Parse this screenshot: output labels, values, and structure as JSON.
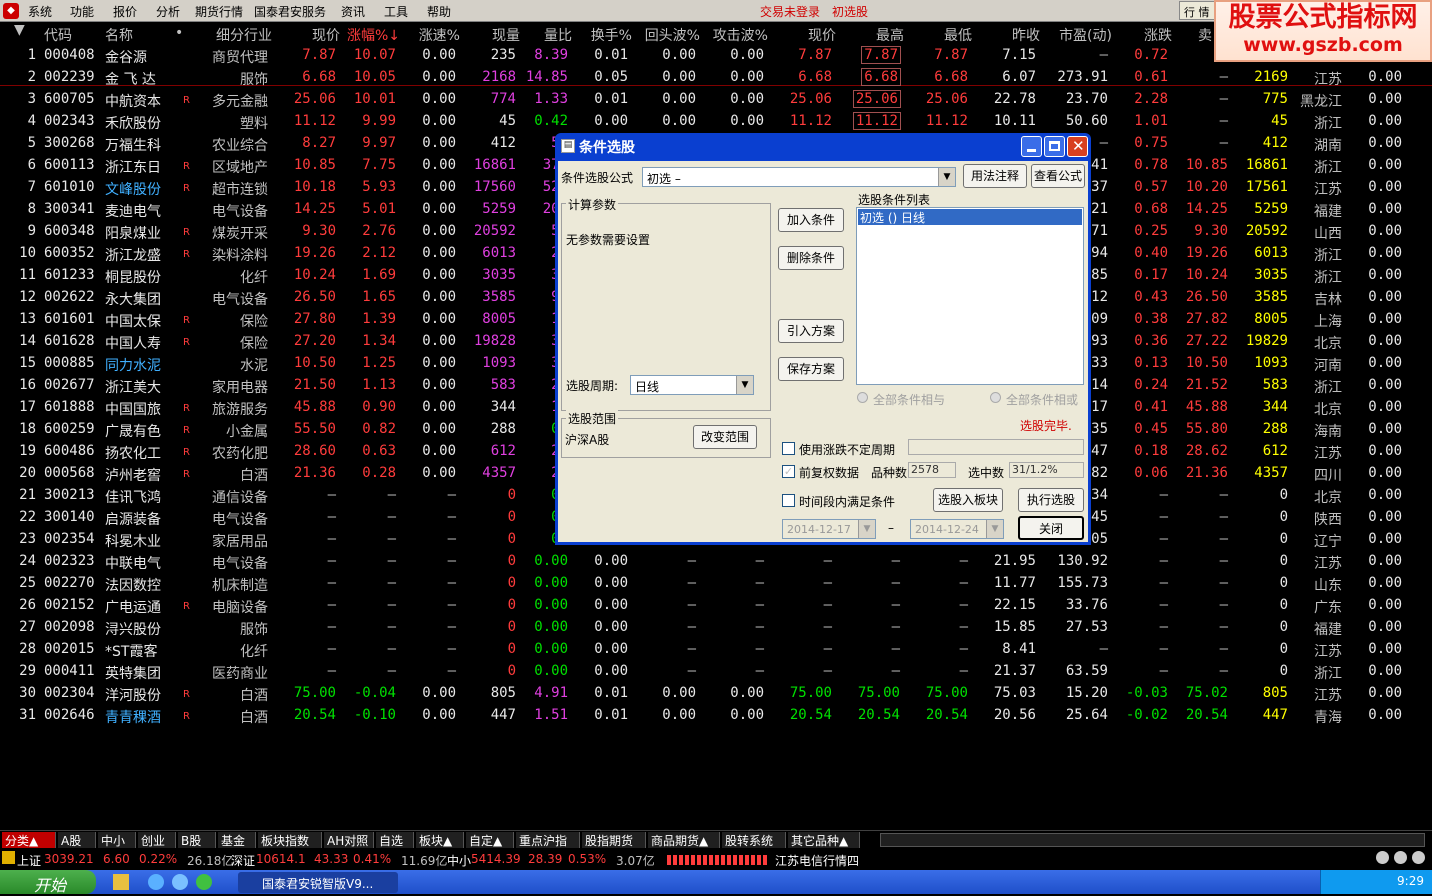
{
  "menu": {
    "items": [
      "系统",
      "功能",
      "报价",
      "分析",
      "期货行情",
      "国泰君安服务",
      "资讯",
      "工具",
      "帮助"
    ],
    "status_login": "交易未登录",
    "status_filter": "初选股",
    "right_btn": "行 情"
  },
  "watermark": {
    "line1": "股票公式指标网",
    "line2": "www.gszb.com"
  },
  "columns": [
    "代码",
    "名称",
    "•",
    "细分行业",
    "现价",
    "涨幅%↓",
    "涨速%",
    "现量",
    "量比",
    "换手%",
    "回头波%",
    "攻击波%",
    "现价",
    "最高",
    "最低",
    "昨收",
    "市盈(动)",
    "涨跌",
    "卖",
    "",
    "",
    ""
  ],
  "rows": [
    {
      "n": "1",
      "code": "000408",
      "name": "金谷源",
      "r": "",
      "ind": "商贸代理",
      "price": "7.87",
      "chg": "10.07",
      "spd": "0.00",
      "vol": "235",
      "vr": "8.39",
      "to": "0.01",
      "hb": "0.00",
      "ab": "0.00",
      "p2": "7.87",
      "hi": "7.87",
      "lo": "7.87",
      "pc": "7.15",
      "pe": "–",
      "ud": "0.72",
      "sell": "",
      "amt": "",
      "reg": "",
      "x": ""
    },
    {
      "n": "2",
      "code": "002239",
      "name": "金 飞 达",
      "r": "",
      "ind": "服饰",
      "price": "6.68",
      "chg": "10.05",
      "spd": "0.00",
      "vol": "2168",
      "vr": "14.85",
      "to": "0.05",
      "hb": "0.00",
      "ab": "0.00",
      "p2": "6.68",
      "hi": "6.68",
      "lo": "6.68",
      "pc": "6.07",
      "pe": "273.91",
      "ud": "0.61",
      "sell": "–",
      "amt": "2169",
      "reg": "江苏",
      "x": "0.00"
    },
    {
      "n": "3",
      "code": "600705",
      "name": "中航资本",
      "r": "R",
      "ind": "多元金融",
      "price": "25.06",
      "chg": "10.01",
      "spd": "0.00",
      "vol": "774",
      "vr": "1.33",
      "to": "0.01",
      "hb": "0.00",
      "ab": "0.00",
      "p2": "25.06",
      "hi": "25.06",
      "lo": "25.06",
      "pc": "22.78",
      "pe": "23.70",
      "ud": "2.28",
      "sell": "–",
      "amt": "775",
      "reg": "黑龙江",
      "x": "0.00"
    },
    {
      "n": "4",
      "code": "002343",
      "name": "禾欣股份",
      "r": "",
      "ind": "塑料",
      "price": "11.12",
      "chg": "9.99",
      "spd": "0.00",
      "vol": "45",
      "vr": "0.42",
      "to": "0.00",
      "hb": "0.00",
      "ab": "0.00",
      "p2": "11.12",
      "hi": "11.12",
      "lo": "11.12",
      "pc": "10.11",
      "pe": "50.60",
      "ud": "1.01",
      "sell": "–",
      "amt": "45",
      "reg": "浙江",
      "x": "0.00"
    },
    {
      "n": "5",
      "code": "300268",
      "name": "万福生科",
      "r": "",
      "ind": "农业综合",
      "price": "8.27",
      "chg": "9.97",
      "spd": "0.00",
      "vol": "412",
      "vr": "5.",
      "to": "",
      "hb": "",
      "ab": "",
      "p2": "",
      "hi": "",
      "lo": "",
      "pc": "",
      "pe": "–",
      "ud": "0.75",
      "sell": "–",
      "amt": "412",
      "reg": "湖南",
      "x": "0.00"
    },
    {
      "n": "6",
      "code": "600113",
      "name": "浙江东日",
      "r": "R",
      "ind": "区域地产",
      "price": "10.85",
      "chg": "7.75",
      "spd": "0.00",
      "vol": "16861",
      "vr": "37.",
      "to": "",
      "hb": "",
      "ab": "",
      "p2": "",
      "hi": "",
      "lo": "",
      "pc": "",
      "pe": "41",
      "ud": "0.78",
      "sell": "10.85",
      "amt": "16861",
      "reg": "浙江",
      "x": "0.00"
    },
    {
      "n": "7",
      "code": "601010",
      "name": "文峰股份",
      "r": "R",
      "ind": "超市连锁",
      "price": "10.18",
      "chg": "5.93",
      "spd": "0.00",
      "vol": "17560",
      "vr": "52.",
      "to": "",
      "hb": "",
      "ab": "",
      "p2": "",
      "hi": "",
      "lo": "",
      "pc": "",
      "pe": "37",
      "ud": "0.57",
      "sell": "10.20",
      "amt": "17561",
      "reg": "江苏",
      "x": "0.00"
    },
    {
      "n": "8",
      "code": "300341",
      "name": "麦迪电气",
      "r": "",
      "ind": "电气设备",
      "price": "14.25",
      "chg": "5.01",
      "spd": "0.00",
      "vol": "5259",
      "vr": "20.",
      "to": "",
      "hb": "",
      "ab": "",
      "p2": "",
      "hi": "",
      "lo": "",
      "pc": "",
      "pe": "21",
      "ud": "0.68",
      "sell": "14.25",
      "amt": "5259",
      "reg": "福建",
      "x": "0.00"
    },
    {
      "n": "9",
      "code": "600348",
      "name": "阳泉煤业",
      "r": "R",
      "ind": "煤炭开采",
      "price": "9.30",
      "chg": "2.76",
      "spd": "0.00",
      "vol": "20592",
      "vr": "5.",
      "to": "",
      "hb": "",
      "ab": "",
      "p2": "",
      "hi": "",
      "lo": "",
      "pc": "",
      "pe": "71",
      "ud": "0.25",
      "sell": "9.30",
      "amt": "20592",
      "reg": "山西",
      "x": "0.00"
    },
    {
      "n": "10",
      "code": "600352",
      "name": "浙江龙盛",
      "r": "R",
      "ind": "染料涂料",
      "price": "19.26",
      "chg": "2.12",
      "spd": "0.00",
      "vol": "6013",
      "vr": "2.",
      "to": "",
      "hb": "",
      "ab": "",
      "p2": "",
      "hi": "",
      "lo": "",
      "pc": "",
      "pe": "94",
      "ud": "0.40",
      "sell": "19.26",
      "amt": "6013",
      "reg": "浙江",
      "x": "0.00"
    },
    {
      "n": "11",
      "code": "601233",
      "name": "桐昆股份",
      "r": "",
      "ind": "化纤",
      "price": "10.24",
      "chg": "1.69",
      "spd": "0.00",
      "vol": "3035",
      "vr": "3.",
      "to": "",
      "hb": "",
      "ab": "",
      "p2": "",
      "hi": "",
      "lo": "",
      "pc": "",
      "pe": "85",
      "ud": "0.17",
      "sell": "10.24",
      "amt": "3035",
      "reg": "浙江",
      "x": "0.00"
    },
    {
      "n": "12",
      "code": "002622",
      "name": "永大集团",
      "r": "",
      "ind": "电气设备",
      "price": "26.50",
      "chg": "1.65",
      "spd": "0.00",
      "vol": "3585",
      "vr": "9.",
      "to": "",
      "hb": "",
      "ab": "",
      "p2": "",
      "hi": "",
      "lo": "",
      "pc": "",
      "pe": "12",
      "ud": "0.43",
      "sell": "26.50",
      "amt": "3585",
      "reg": "吉林",
      "x": "0.00"
    },
    {
      "n": "13",
      "code": "601601",
      "name": "中国太保",
      "r": "R",
      "ind": "保险",
      "price": "27.80",
      "chg": "1.39",
      "spd": "0.00",
      "vol": "8005",
      "vr": "1.",
      "to": "",
      "hb": "",
      "ab": "",
      "p2": "",
      "hi": "",
      "lo": "",
      "pc": "",
      "pe": "09",
      "ud": "0.38",
      "sell": "27.82",
      "amt": "8005",
      "reg": "上海",
      "x": "0.00"
    },
    {
      "n": "14",
      "code": "601628",
      "name": "中国人寿",
      "r": "R",
      "ind": "保险",
      "price": "27.20",
      "chg": "1.34",
      "spd": "0.00",
      "vol": "19828",
      "vr": "3.",
      "to": "",
      "hb": "",
      "ab": "",
      "p2": "",
      "hi": "",
      "lo": "",
      "pc": "",
      "pe": "93",
      "ud": "0.36",
      "sell": "27.22",
      "amt": "19829",
      "reg": "北京",
      "x": "0.00"
    },
    {
      "n": "15",
      "code": "000885",
      "name": "同力水泥",
      "r": "",
      "ind": "水泥",
      "price": "10.50",
      "chg": "1.25",
      "spd": "0.00",
      "vol": "1093",
      "vr": "3.",
      "to": "",
      "hb": "",
      "ab": "",
      "p2": "",
      "hi": "",
      "lo": "",
      "pc": "",
      "pe": "33",
      "ud": "0.13",
      "sell": "10.50",
      "amt": "1093",
      "reg": "河南",
      "x": "0.00"
    },
    {
      "n": "16",
      "code": "002677",
      "name": "浙江美大",
      "r": "",
      "ind": "家用电器",
      "price": "21.50",
      "chg": "1.13",
      "spd": "0.00",
      "vol": "583",
      "vr": "2.",
      "to": "",
      "hb": "",
      "ab": "",
      "p2": "",
      "hi": "",
      "lo": "",
      "pc": "",
      "pe": "14",
      "ud": "0.24",
      "sell": "21.52",
      "amt": "583",
      "reg": "浙江",
      "x": "0.00"
    },
    {
      "n": "17",
      "code": "601888",
      "name": "中国国旅",
      "r": "R",
      "ind": "旅游服务",
      "price": "45.88",
      "chg": "0.90",
      "spd": "0.00",
      "vol": "344",
      "vr": "1.",
      "to": "",
      "hb": "",
      "ab": "",
      "p2": "",
      "hi": "",
      "lo": "",
      "pc": "",
      "pe": "17",
      "ud": "0.41",
      "sell": "45.88",
      "amt": "344",
      "reg": "北京",
      "x": "0.00"
    },
    {
      "n": "18",
      "code": "600259",
      "name": "广晟有色",
      "r": "R",
      "ind": "小金属",
      "price": "55.50",
      "chg": "0.82",
      "spd": "0.00",
      "vol": "288",
      "vr": "0.",
      "to": "",
      "hb": "",
      "ab": "",
      "p2": "",
      "hi": "",
      "lo": "",
      "pc": "",
      "pe": "35",
      "ud": "0.45",
      "sell": "55.80",
      "amt": "288",
      "reg": "海南",
      "x": "0.00"
    },
    {
      "n": "19",
      "code": "600486",
      "name": "扬农化工",
      "r": "R",
      "ind": "农药化肥",
      "price": "28.60",
      "chg": "0.63",
      "spd": "0.00",
      "vol": "612",
      "vr": "2.",
      "to": "",
      "hb": "",
      "ab": "",
      "p2": "",
      "hi": "",
      "lo": "",
      "pc": "",
      "pe": "47",
      "ud": "0.18",
      "sell": "28.62",
      "amt": "612",
      "reg": "江苏",
      "x": "0.00"
    },
    {
      "n": "20",
      "code": "000568",
      "name": "泸州老窖",
      "r": "R",
      "ind": "白酒",
      "price": "21.36",
      "chg": "0.28",
      "spd": "0.00",
      "vol": "4357",
      "vr": "2.",
      "to": "",
      "hb": "",
      "ab": "",
      "p2": "",
      "hi": "",
      "lo": "",
      "pc": "",
      "pe": "82",
      "ud": "0.06",
      "sell": "21.36",
      "amt": "4357",
      "reg": "四川",
      "x": "0.00"
    },
    {
      "n": "21",
      "code": "300213",
      "name": "佳讯飞鸿",
      "r": "",
      "ind": "通信设备",
      "price": "–",
      "chg": "–",
      "spd": "–",
      "vol": "0",
      "vr": "0.",
      "to": "",
      "hb": "",
      "ab": "",
      "p2": "",
      "hi": "",
      "lo": "",
      "pc": "",
      "pe": "34",
      "ud": "–",
      "sell": "–",
      "amt": "0",
      "reg": "北京",
      "x": "0.00"
    },
    {
      "n": "22",
      "code": "300140",
      "name": "启源装备",
      "r": "",
      "ind": "电气设备",
      "price": "–",
      "chg": "–",
      "spd": "–",
      "vol": "0",
      "vr": "0.",
      "to": "",
      "hb": "",
      "ab": "",
      "p2": "",
      "hi": "",
      "lo": "",
      "pc": "",
      "pe": "45",
      "ud": "–",
      "sell": "–",
      "amt": "0",
      "reg": "陕西",
      "x": "0.00"
    },
    {
      "n": "23",
      "code": "002354",
      "name": "科冕木业",
      "r": "",
      "ind": "家居用品",
      "price": "–",
      "chg": "–",
      "spd": "–",
      "vol": "0",
      "vr": "0.",
      "to": "",
      "hb": "",
      "ab": "",
      "p2": "",
      "hi": "",
      "lo": "",
      "pc": "",
      "pe": "05",
      "ud": "–",
      "sell": "–",
      "amt": "0",
      "reg": "辽宁",
      "x": "0.00"
    },
    {
      "n": "24",
      "code": "002323",
      "name": "中联电气",
      "r": "",
      "ind": "电气设备",
      "price": "–",
      "chg": "–",
      "spd": "–",
      "vol": "0",
      "vr": "0.00",
      "to": "0.00",
      "hb": "–",
      "ab": "–",
      "p2": "–",
      "hi": "–",
      "lo": "–",
      "pc": "21.95",
      "pe": "130.92",
      "ud": "–",
      "sell": "–",
      "amt": "0",
      "reg": "江苏",
      "x": "0.00"
    },
    {
      "n": "25",
      "code": "002270",
      "name": "法因数控",
      "r": "",
      "ind": "机床制造",
      "price": "–",
      "chg": "–",
      "spd": "–",
      "vol": "0",
      "vr": "0.00",
      "to": "0.00",
      "hb": "–",
      "ab": "–",
      "p2": "–",
      "hi": "–",
      "lo": "–",
      "pc": "11.77",
      "pe": "155.73",
      "ud": "–",
      "sell": "–",
      "amt": "0",
      "reg": "山东",
      "x": "0.00"
    },
    {
      "n": "26",
      "code": "002152",
      "name": "广电运通",
      "r": "R",
      "ind": "电脑设备",
      "price": "–",
      "chg": "–",
      "spd": "–",
      "vol": "0",
      "vr": "0.00",
      "to": "0.00",
      "hb": "–",
      "ab": "–",
      "p2": "–",
      "hi": "–",
      "lo": "–",
      "pc": "22.15",
      "pe": "33.76",
      "ud": "–",
      "sell": "–",
      "amt": "0",
      "reg": "广东",
      "x": "0.00"
    },
    {
      "n": "27",
      "code": "002098",
      "name": "浔兴股份",
      "r": "",
      "ind": "服饰",
      "price": "–",
      "chg": "–",
      "spd": "–",
      "vol": "0",
      "vr": "0.00",
      "to": "0.00",
      "hb": "–",
      "ab": "–",
      "p2": "–",
      "hi": "–",
      "lo": "–",
      "pc": "15.85",
      "pe": "27.53",
      "ud": "–",
      "sell": "–",
      "amt": "0",
      "reg": "福建",
      "x": "0.00"
    },
    {
      "n": "28",
      "code": "002015",
      "name": "*ST霞客",
      "r": "",
      "ind": "化纤",
      "price": "–",
      "chg": "–",
      "spd": "–",
      "vol": "0",
      "vr": "0.00",
      "to": "0.00",
      "hb": "–",
      "ab": "–",
      "p2": "–",
      "hi": "–",
      "lo": "–",
      "pc": "8.41",
      "pe": "–",
      "ud": "–",
      "sell": "–",
      "amt": "0",
      "reg": "江苏",
      "x": "0.00"
    },
    {
      "n": "29",
      "code": "000411",
      "name": "英特集团",
      "r": "",
      "ind": "医药商业",
      "price": "–",
      "chg": "–",
      "spd": "–",
      "vol": "0",
      "vr": "0.00",
      "to": "0.00",
      "hb": "–",
      "ab": "–",
      "p2": "–",
      "hi": "–",
      "lo": "–",
      "pc": "21.37",
      "pe": "63.59",
      "ud": "–",
      "sell": "–",
      "amt": "0",
      "reg": "浙江",
      "x": "0.00"
    },
    {
      "n": "30",
      "code": "002304",
      "name": "洋河股份",
      "r": "R",
      "ind": "白酒",
      "price": "75.00",
      "chg": "-0.04",
      "spd": "0.00",
      "vol": "805",
      "vr": "4.91",
      "to": "0.01",
      "hb": "0.00",
      "ab": "0.00",
      "p2": "75.00",
      "hi": "75.00",
      "lo": "75.00",
      "pc": "75.03",
      "pe": "15.20",
      "ud": "-0.03",
      "sell": "75.02",
      "amt": "805",
      "reg": "江苏",
      "x": "0.00"
    },
    {
      "n": "31",
      "code": "002646",
      "name": "青青稞酒",
      "r": "R",
      "ind": "白酒",
      "price": "20.54",
      "chg": "-0.10",
      "spd": "0.00",
      "vol": "447",
      "vr": "1.51",
      "to": "0.01",
      "hb": "0.00",
      "ab": "0.00",
      "p2": "20.54",
      "hi": "20.54",
      "lo": "20.54",
      "pc": "20.56",
      "pe": "25.64",
      "ud": "-0.02",
      "sell": "20.54",
      "amt": "447",
      "reg": "青海",
      "x": "0.00"
    }
  ],
  "dialog": {
    "title": "条件选股",
    "formula_label": "条件选股公式",
    "formula_value": "初选        –",
    "usage_btn": "用法注释",
    "view_btn": "查看公式",
    "params_group": "计算参数",
    "params_text": "无参数需要设置",
    "period_label": "选股周期:",
    "period_value": "日线",
    "scope_group": "选股范围",
    "scope_value": "沪深A股",
    "change_scope_btn": "改变范围",
    "add_btn": "加入条件",
    "delete_btn": "删除条件",
    "import_btn": "引入方案",
    "save_btn": "保存方案",
    "list_label": "选股条件列表",
    "list_item": "初选  () 日线",
    "radio_and": "全部条件相与",
    "radio_or": "全部条件相或",
    "done": "选股完毕.",
    "use_period_label": "使用涨跌不定周期",
    "fq_label": "前复权数据",
    "count_label": "品种数",
    "count_value": "2578",
    "selected_label": "选中数",
    "selected_value": "31/1.2%",
    "time_label": "时间段内满足条件",
    "to_block_btn": "选股入板块",
    "exec_btn": "执行选股",
    "date_from": "2014-12-17",
    "date_sep": "–",
    "date_to": "2014-12-24",
    "close_btn": "关闭"
  },
  "tabs": [
    "分类▲",
    "A股",
    "中小",
    "创业",
    "B股",
    "基金",
    "板块指数",
    "AH对照",
    "自选",
    "板块▲",
    "自定▲",
    "重点沪指",
    "股指期货",
    "商品期货▲",
    "股转系统",
    "其它品种▲"
  ],
  "indexbar": {
    "sh_label": "上证",
    "sh_val": "3039.21",
    "sh_chg": "6.60",
    "sh_pct": "0.22%",
    "sh_amt": "26.18亿",
    "sz_label": "深证",
    "sz_val": "10614.1",
    "sz_chg": "43.33",
    "sz_pct": "0.41%",
    "sz_amt": "11.69亿",
    "zx_label": "中小",
    "zx_val": "5414.39",
    "zx_chg": "28.39",
    "zx_pct": "0.53%",
    "zx_amt": "3.07亿",
    "server": "江苏电信行情四"
  },
  "taskbar": {
    "start": "开始",
    "app": "国泰君安锐智版V9...",
    "clock": "9:29"
  }
}
